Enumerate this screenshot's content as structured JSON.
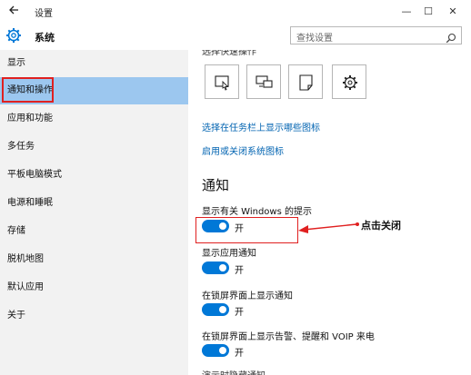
{
  "window": {
    "title": "设置",
    "back_icon": "back-arrow-icon",
    "minimize": "—",
    "maximize": "☐",
    "close": "✕"
  },
  "header": {
    "icon": "gear-icon",
    "title": "系统",
    "search_placeholder": "查找设置"
  },
  "sidebar": {
    "items": [
      {
        "label": "显示"
      },
      {
        "label": "通知和操作",
        "active": true
      },
      {
        "label": "应用和功能"
      },
      {
        "label": "多任务"
      },
      {
        "label": "平板电脑模式"
      },
      {
        "label": "电源和睡眠"
      },
      {
        "label": "存储"
      },
      {
        "label": "脱机地图"
      },
      {
        "label": "默认应用"
      },
      {
        "label": "关于"
      }
    ]
  },
  "content": {
    "partial_top_text": "选择快速操作",
    "quick_actions": [
      "tablet-mode-icon",
      "project-icon",
      "note-icon",
      "settings-gear-icon"
    ],
    "links": {
      "taskbar_icons": "选择在任务栏上显示哪些图标",
      "system_icons": "启用或关闭系统图标"
    },
    "section_title": "通知",
    "settings": [
      {
        "label": "显示有关 Windows 的提示",
        "state": "开",
        "on": true
      },
      {
        "label": "显示应用通知",
        "state": "开",
        "on": true
      },
      {
        "label": "在锁屏界面上显示通知",
        "state": "开",
        "on": true
      },
      {
        "label": "在锁屏界面上显示告警、提醒和 VOIP 来电",
        "state": "开",
        "on": true
      }
    ],
    "partial_bottom_text": "演示时隐藏通知"
  },
  "annotation": {
    "text": "点击关闭",
    "color": "#e02020"
  },
  "colors": {
    "accent": "#0078d7",
    "sidebar_bg": "#f2f2f2",
    "active_item_bg": "#9cc7ef",
    "link": "#0063b1"
  }
}
